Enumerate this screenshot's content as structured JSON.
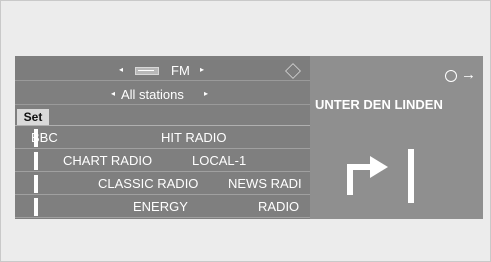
{
  "source": {
    "band": "FM",
    "filter": "All stations"
  },
  "buttons": {
    "set": "Set"
  },
  "stations": [
    {
      "a": "BBC",
      "b": "HIT RADIO"
    },
    {
      "a": "CHART RADIO",
      "b": "LOCAL-1"
    },
    {
      "a": "CLASSIC RADIO",
      "b": "NEWS RADI"
    },
    {
      "a": "ENERGY",
      "b": "RADIO"
    }
  ],
  "nav": {
    "street": "UNTER DEN LINDEN",
    "arrow_glyph": "→",
    "maneuver_icon": "turn-right-icon"
  },
  "icons": {
    "left": "◂",
    "right": "▸",
    "clock": "clock-icon",
    "nav": "nav-direction-icon"
  },
  "colors": {
    "panel_dark": "#7f7f7f",
    "panel_light": "#8f8f8f",
    "text": "#ffffff"
  }
}
